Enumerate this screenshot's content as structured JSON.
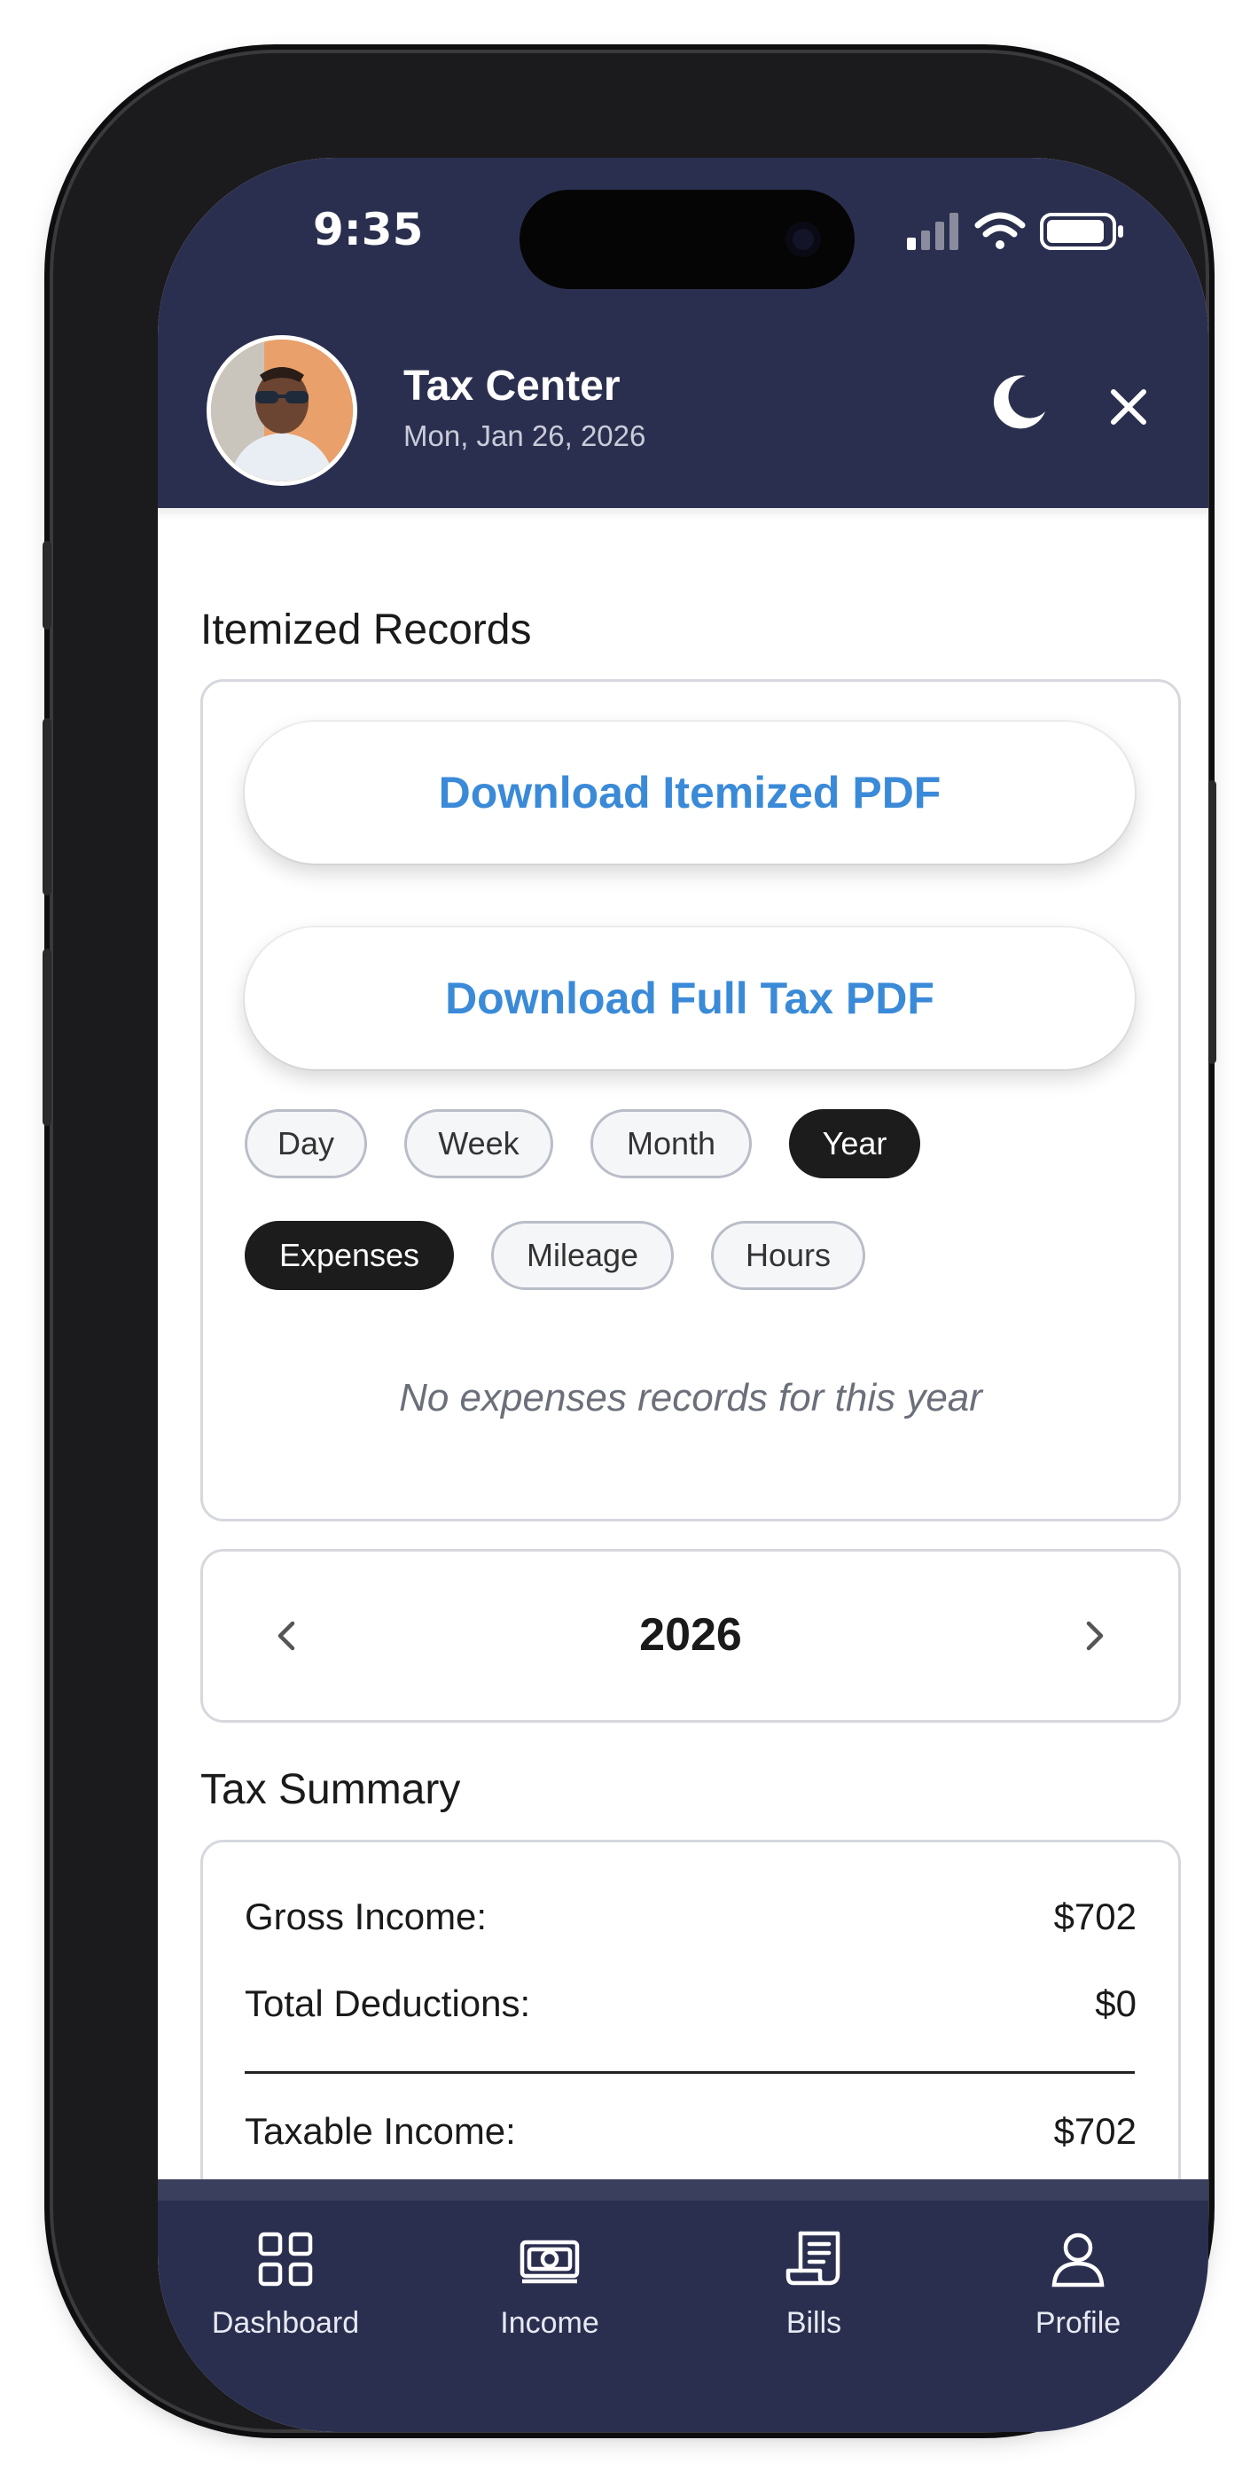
{
  "status_bar": {
    "time": "9:35"
  },
  "header": {
    "title": "Tax Center",
    "date": "Mon, Jan 26, 2026",
    "icons": [
      "moon-icon",
      "close-icon"
    ]
  },
  "itemized": {
    "section_title": "Itemized Records",
    "download_itemized_label": "Download Itemized PDF",
    "download_full_label": "Download Full Tax PDF",
    "period_filters": [
      {
        "label": "Day",
        "active": false
      },
      {
        "label": "Week",
        "active": false
      },
      {
        "label": "Month",
        "active": false
      },
      {
        "label": "Year",
        "active": true
      }
    ],
    "type_filters": [
      {
        "label": "Expenses",
        "active": true
      },
      {
        "label": "Mileage",
        "active": false
      },
      {
        "label": "Hours",
        "active": false
      }
    ],
    "empty_message": "No expenses records for this year"
  },
  "year_selector": {
    "year": "2026"
  },
  "tax_summary": {
    "section_title": "Tax Summary",
    "rows": [
      {
        "label": "Gross Income:",
        "value": "$702"
      },
      {
        "label": "Total Deductions:",
        "value": "$0"
      },
      {
        "label": "Taxable Income:",
        "value": "$702"
      }
    ]
  },
  "tabbar": {
    "items": [
      {
        "label": "Dashboard",
        "icon": "grid-icon"
      },
      {
        "label": "Income",
        "icon": "cash-icon"
      },
      {
        "label": "Bills",
        "icon": "receipt-icon"
      },
      {
        "label": "Profile",
        "icon": "person-icon"
      }
    ]
  },
  "colors": {
    "header_bg": "#2b2f4f",
    "accent_link": "#3a8ad8",
    "chip_active": "#1c1c1c"
  }
}
